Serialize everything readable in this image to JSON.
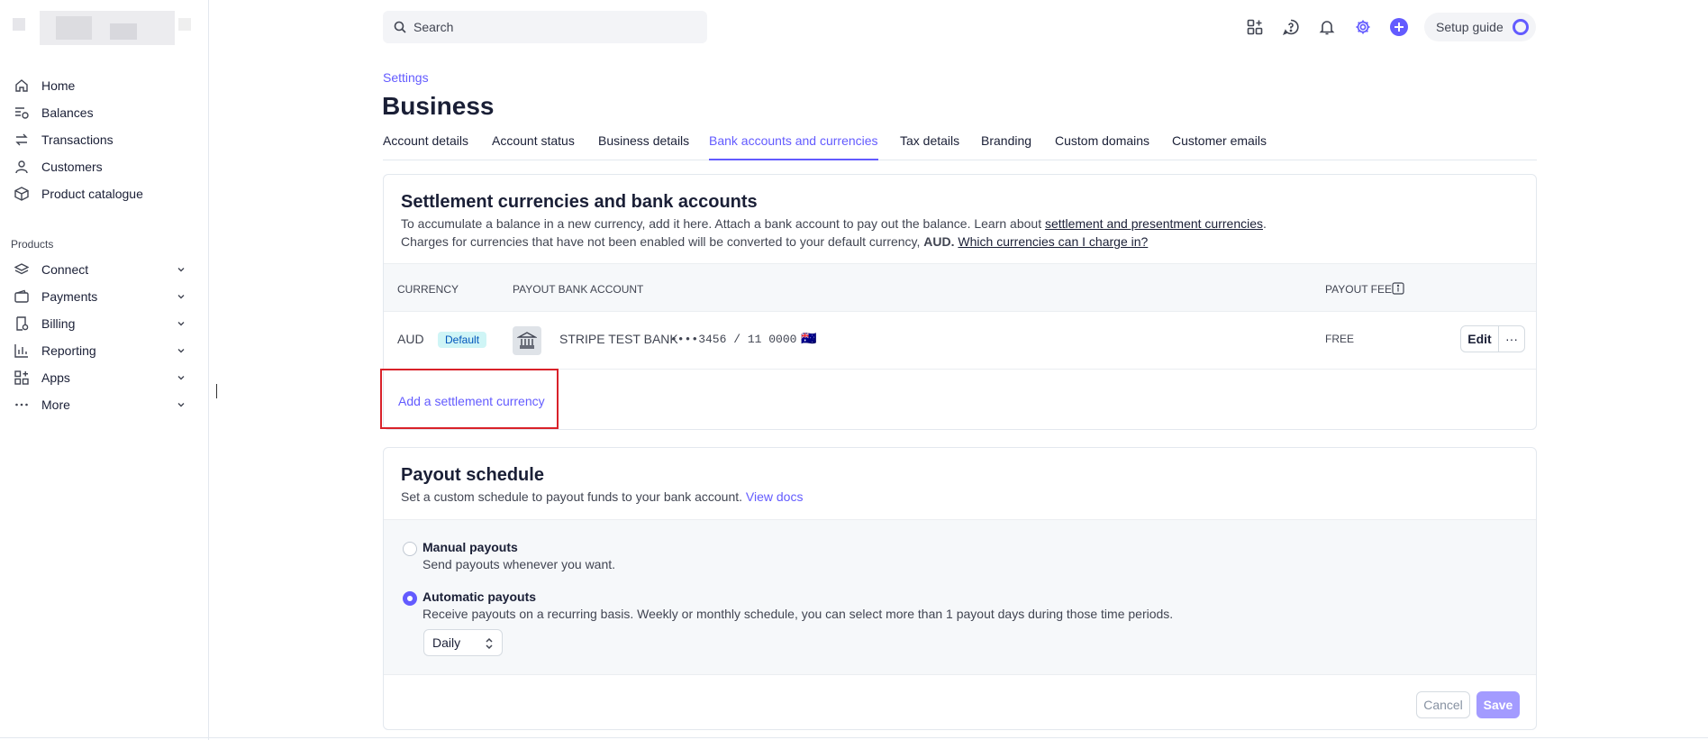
{
  "sidebar": {
    "items": [
      {
        "label": "Home",
        "icon": "home-icon"
      },
      {
        "label": "Balances",
        "icon": "balances-icon"
      },
      {
        "label": "Transactions",
        "icon": "transactions-icon"
      },
      {
        "label": "Customers",
        "icon": "customers-icon"
      },
      {
        "label": "Product catalogue",
        "icon": "product-catalogue-icon"
      }
    ],
    "products_label": "Products",
    "products": [
      {
        "label": "Connect",
        "icon": "connect-icon"
      },
      {
        "label": "Payments",
        "icon": "payments-icon"
      },
      {
        "label": "Billing",
        "icon": "billing-icon"
      },
      {
        "label": "Reporting",
        "icon": "reporting-icon"
      },
      {
        "label": "Apps",
        "icon": "apps-icon"
      },
      {
        "label": "More",
        "icon": "more-icon"
      }
    ]
  },
  "topbar": {
    "search_placeholder": "Search",
    "setup_guide": "Setup guide"
  },
  "header": {
    "breadcrumb": "Settings",
    "title": "Business",
    "tabs": [
      {
        "label": "Account details"
      },
      {
        "label": "Account status"
      },
      {
        "label": "Business details"
      },
      {
        "label": "Bank accounts and currencies",
        "active": true
      },
      {
        "label": "Tax details"
      },
      {
        "label": "Branding"
      },
      {
        "label": "Custom domains"
      },
      {
        "label": "Customer emails"
      }
    ]
  },
  "settlement": {
    "title": "Settlement currencies and bank accounts",
    "desc1_a": "To accumulate a balance in a new currency, add it here. Attach a bank account to pay out the balance. Learn about ",
    "desc1_link": "settlement and presentment currencies",
    "desc1_b": ".",
    "desc2_a": "Charges for currencies that have not been enabled will be converted to your default currency, ",
    "desc2_strong": "AUD.",
    "desc2_link": "Which currencies can I charge in?",
    "columns": {
      "currency": "CURRENCY",
      "account": "PAYOUT BANK ACCOUNT",
      "fee": "PAYOUT FEE"
    },
    "row": {
      "currency": "AUD",
      "badge": "Default",
      "bank": "STRIPE TEST BANK",
      "account": "••••3456 / 11 0000",
      "flag": "🇦🇺",
      "fee": "FREE",
      "edit": "Edit",
      "more": "···"
    },
    "add_link": "Add a settlement currency"
  },
  "payout": {
    "title": "Payout schedule",
    "desc": "Set a custom schedule to payout funds to your bank account.",
    "desc_link": "View docs",
    "manual_title": "Manual payouts",
    "manual_desc": "Send payouts whenever you want.",
    "auto_title": "Automatic payouts",
    "auto_desc": "Receive payouts on a recurring basis. Weekly or monthly schedule, you can select more than 1 payout days during those time periods.",
    "frequency": "Daily",
    "cancel": "Cancel",
    "save": "Save"
  },
  "colors": {
    "accent": "#635bff",
    "highlight": "#d9222a",
    "badge_bg": "#cff5f6"
  }
}
